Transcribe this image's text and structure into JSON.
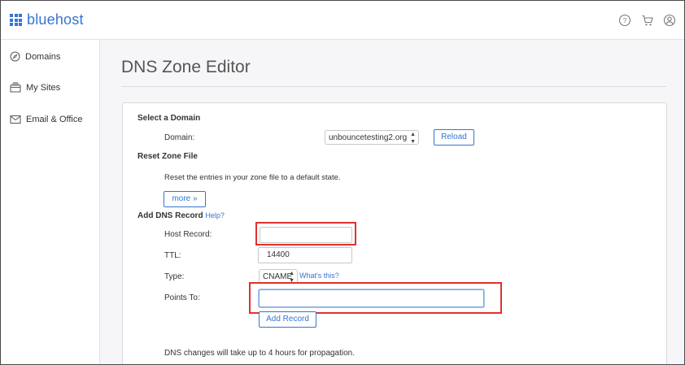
{
  "header": {
    "logo_text": "bluehost",
    "brand_color": "#3575d3",
    "icons": [
      "help-icon",
      "cart-icon",
      "user-icon"
    ]
  },
  "sidebar": {
    "items": [
      {
        "label": "Domains",
        "icon": "compass-icon"
      },
      {
        "label": "My Sites",
        "icon": "sites-icon"
      },
      {
        "label": "Email & Office",
        "icon": "mail-icon"
      }
    ]
  },
  "main": {
    "title": "DNS Zone Editor",
    "select_domain": {
      "title": "Select a Domain",
      "domain_label": "Domain:",
      "domain_value": "unbouncetesting2.org",
      "reload_label": "Reload"
    },
    "reset_zone": {
      "title": "Reset Zone File",
      "description": "Reset the entries in your zone file to a default state.",
      "more_label": "more »"
    },
    "add_record": {
      "title": "Add DNS Record",
      "help_label": "Help?",
      "host_label": "Host Record:",
      "host_value": "",
      "ttl_label": "TTL:",
      "ttl_value": "14400",
      "type_label": "Type:",
      "type_value": "CNAME",
      "whats_this_label": "What's this?",
      "points_label": "Points To:",
      "points_value": "",
      "add_label": "Add Record",
      "note": "DNS changes will take up to 4 hours for propagation."
    }
  },
  "highlight_color": "#e0312c"
}
